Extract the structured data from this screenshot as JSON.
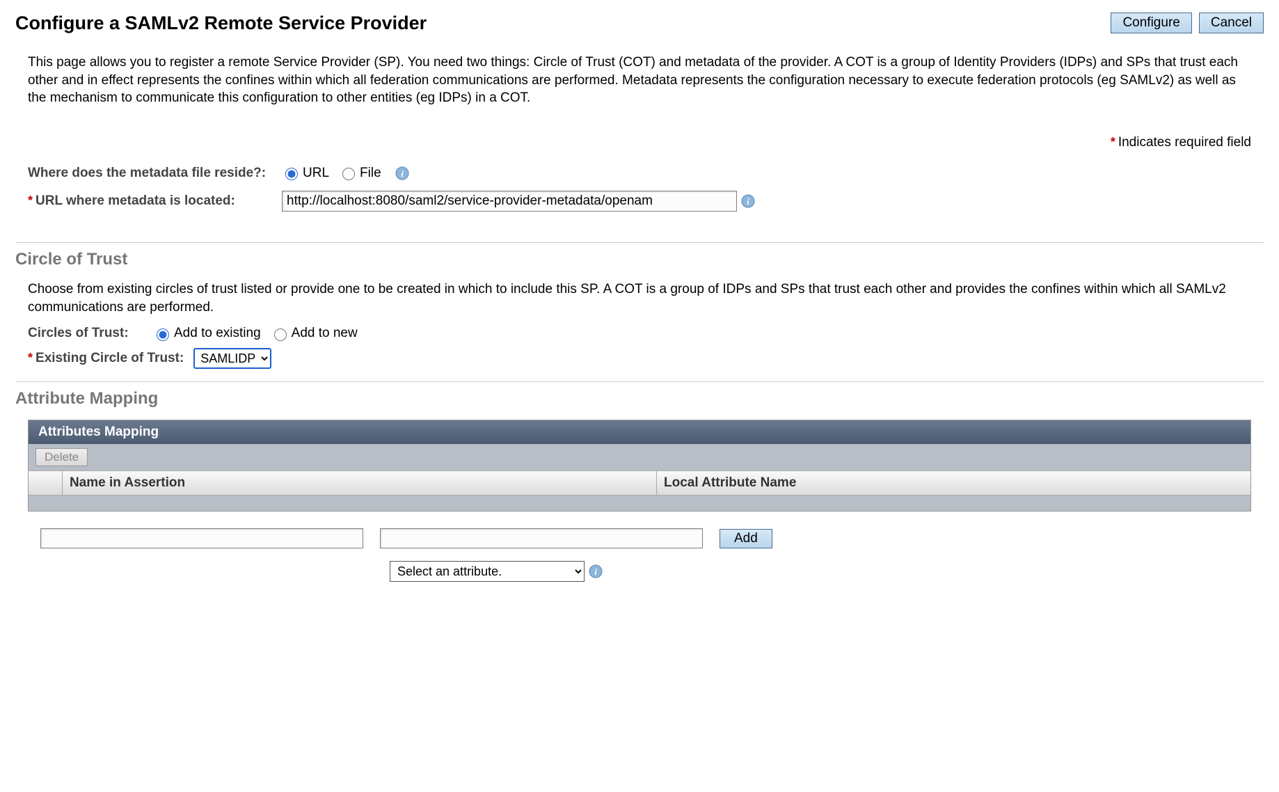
{
  "page_title": "Configure a SAMLv2 Remote Service Provider",
  "buttons": {
    "configure": "Configure",
    "cancel": "Cancel",
    "delete": "Delete",
    "add": "Add"
  },
  "intro": "This page allows you to register a remote Service Provider (SP). You need two things: Circle of Trust (COT) and metadata of the provider. A COT is a group of Identity Providers (IDPs) and SPs that trust each other and in effect represents the confines within which all federation communications are performed. Metadata represents the configuration necessary to execute federation protocols (eg SAMLv2) as well as the mechanism to communicate this configuration to other entities (eg IDPs) in a COT.",
  "required_indicator": "Indicates required field",
  "metadata": {
    "where_label": "Where does the metadata file reside?:",
    "url_opt": "URL",
    "file_opt": "File",
    "location_label": "URL where metadata is located:",
    "location_value": "http://localhost:8080/saml2/service-provider-metadata/openam"
  },
  "cot": {
    "heading": "Circle of Trust",
    "desc": "Choose from existing circles of trust listed or provide one to be created in which to include this SP. A COT is a group of IDPs and SPs that trust each other and provides the confines within which all SAMLv2 communications are performed.",
    "cot_label": "Circles of Trust:",
    "add_existing": "Add to existing",
    "add_new": "Add to new",
    "existing_label": "Existing Circle of Trust:",
    "selected": "SAMLIDP"
  },
  "attr": {
    "heading": "Attribute Mapping",
    "panel_title": "Attributes Mapping",
    "col_name_assertion": "Name in Assertion",
    "col_local_attr": "Local Attribute Name",
    "select_placeholder": "Select an attribute."
  }
}
